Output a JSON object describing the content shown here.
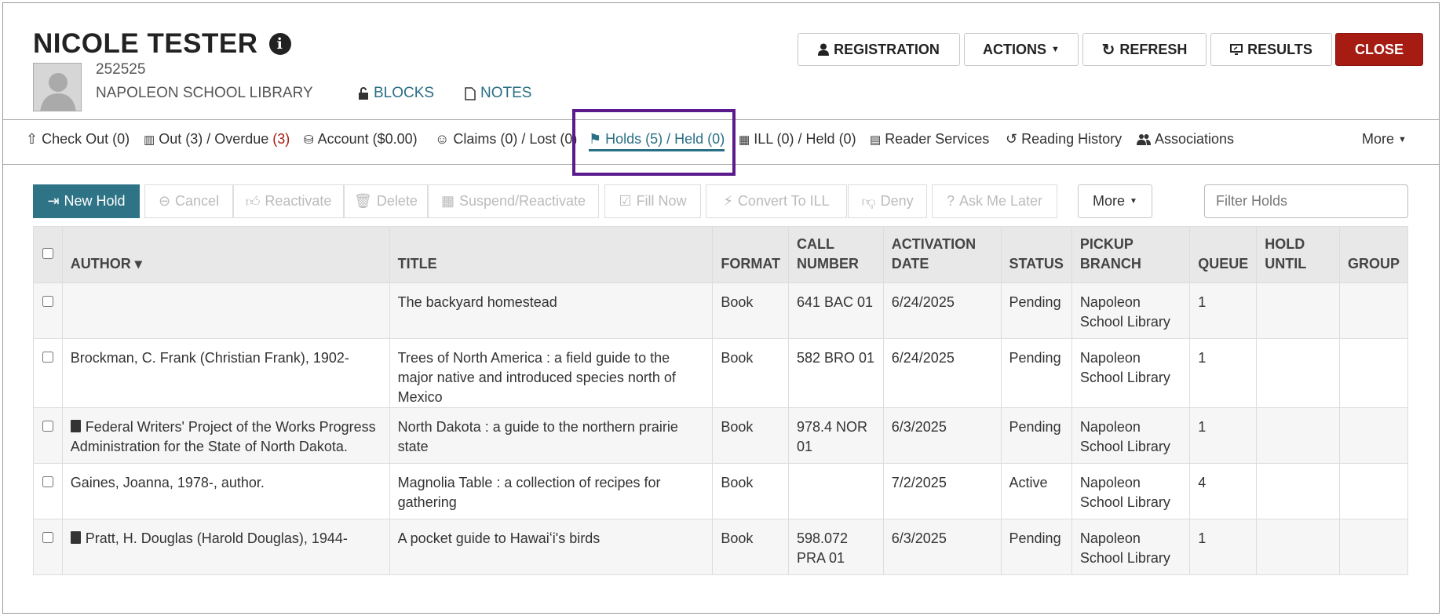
{
  "patron": {
    "name": "NICOLE TESTER",
    "barcode": "252525",
    "library": "NAPOLEON SCHOOL LIBRARY",
    "blocks_label": "BLOCKS",
    "notes_label": "NOTES"
  },
  "header_buttons": {
    "registration": "REGISTRATION",
    "actions": "ACTIONS",
    "refresh": "REFRESH",
    "results": "RESULTS",
    "close": "CLOSE"
  },
  "tabs": {
    "checkout": "Check Out (0)",
    "out": "Out (3) / Overdue ",
    "overdue_count": "(3)",
    "account": "Account ($0.00)",
    "claims": "Claims (0) / Lost (0)",
    "holds": "Holds (5) / Held (0)",
    "ill": "ILL (0) / Held (0)",
    "reader_services": "Reader Services",
    "reading_history": "Reading History",
    "associations": "Associations",
    "more": "More"
  },
  "toolbar": {
    "new_hold": "New Hold",
    "cancel": "Cancel",
    "reactivate": "Reactivate",
    "delete": "Delete",
    "suspend": "Suspend/Reactivate",
    "fill_now": "Fill Now",
    "convert": "Convert To ILL",
    "deny": "Deny",
    "ask_later": "Ask Me Later",
    "more": "More",
    "filter_placeholder": "Filter Holds"
  },
  "columns": {
    "author": "AUTHOR ▾",
    "title": "TITLE",
    "format": "FORMAT",
    "call_number": "CALL NUMBER",
    "activation_date": "ACTIVATION DATE",
    "status": "STATUS",
    "pickup_branch": "PICKUP BRANCH",
    "queue": "QUEUE",
    "hold_until": "HOLD UNTIL",
    "group": "GROUP"
  },
  "rows": [
    {
      "author": "",
      "title": "The backyard homestead",
      "format": "Book",
      "call": "641 BAC 01",
      "date": "6/24/2025",
      "status": "Pending",
      "branch": "Napoleon School Library",
      "queue": "1"
    },
    {
      "author": "Brockman, C. Frank (Christian Frank), 1902-",
      "title": "Trees of North America : a field guide to the major native and introduced species north of Mexico",
      "format": "Book",
      "call": "582 BRO 01",
      "date": "6/24/2025",
      "status": "Pending",
      "branch": "Napoleon School Library",
      "queue": "1"
    },
    {
      "author": "Federal Writers' Project of the Works Progress Administration for the State of North Dakota.",
      "title": "North Dakota : a guide to the northern prairie state",
      "format": "Book",
      "call": "978.4 NOR 01",
      "date": "6/3/2025",
      "status": "Pending",
      "branch": "Napoleon School Library",
      "queue": "1"
    },
    {
      "author": "Gaines, Joanna, 1978-, author.",
      "title": "Magnolia Table : a collection of recipes for gathering",
      "format": "Book",
      "call": "",
      "date": "7/2/2025",
      "status": "Active",
      "branch": "Napoleon School Library",
      "queue": "4"
    },
    {
      "author": "Pratt, H. Douglas (Harold Douglas), 1944-",
      "title": "A pocket guide to Hawaiʻi's birds",
      "format": "Book",
      "call": "598.072 PRA 01",
      "date": "6/3/2025",
      "status": "Pending",
      "branch": "Napoleon School Library",
      "queue": "1"
    }
  ]
}
